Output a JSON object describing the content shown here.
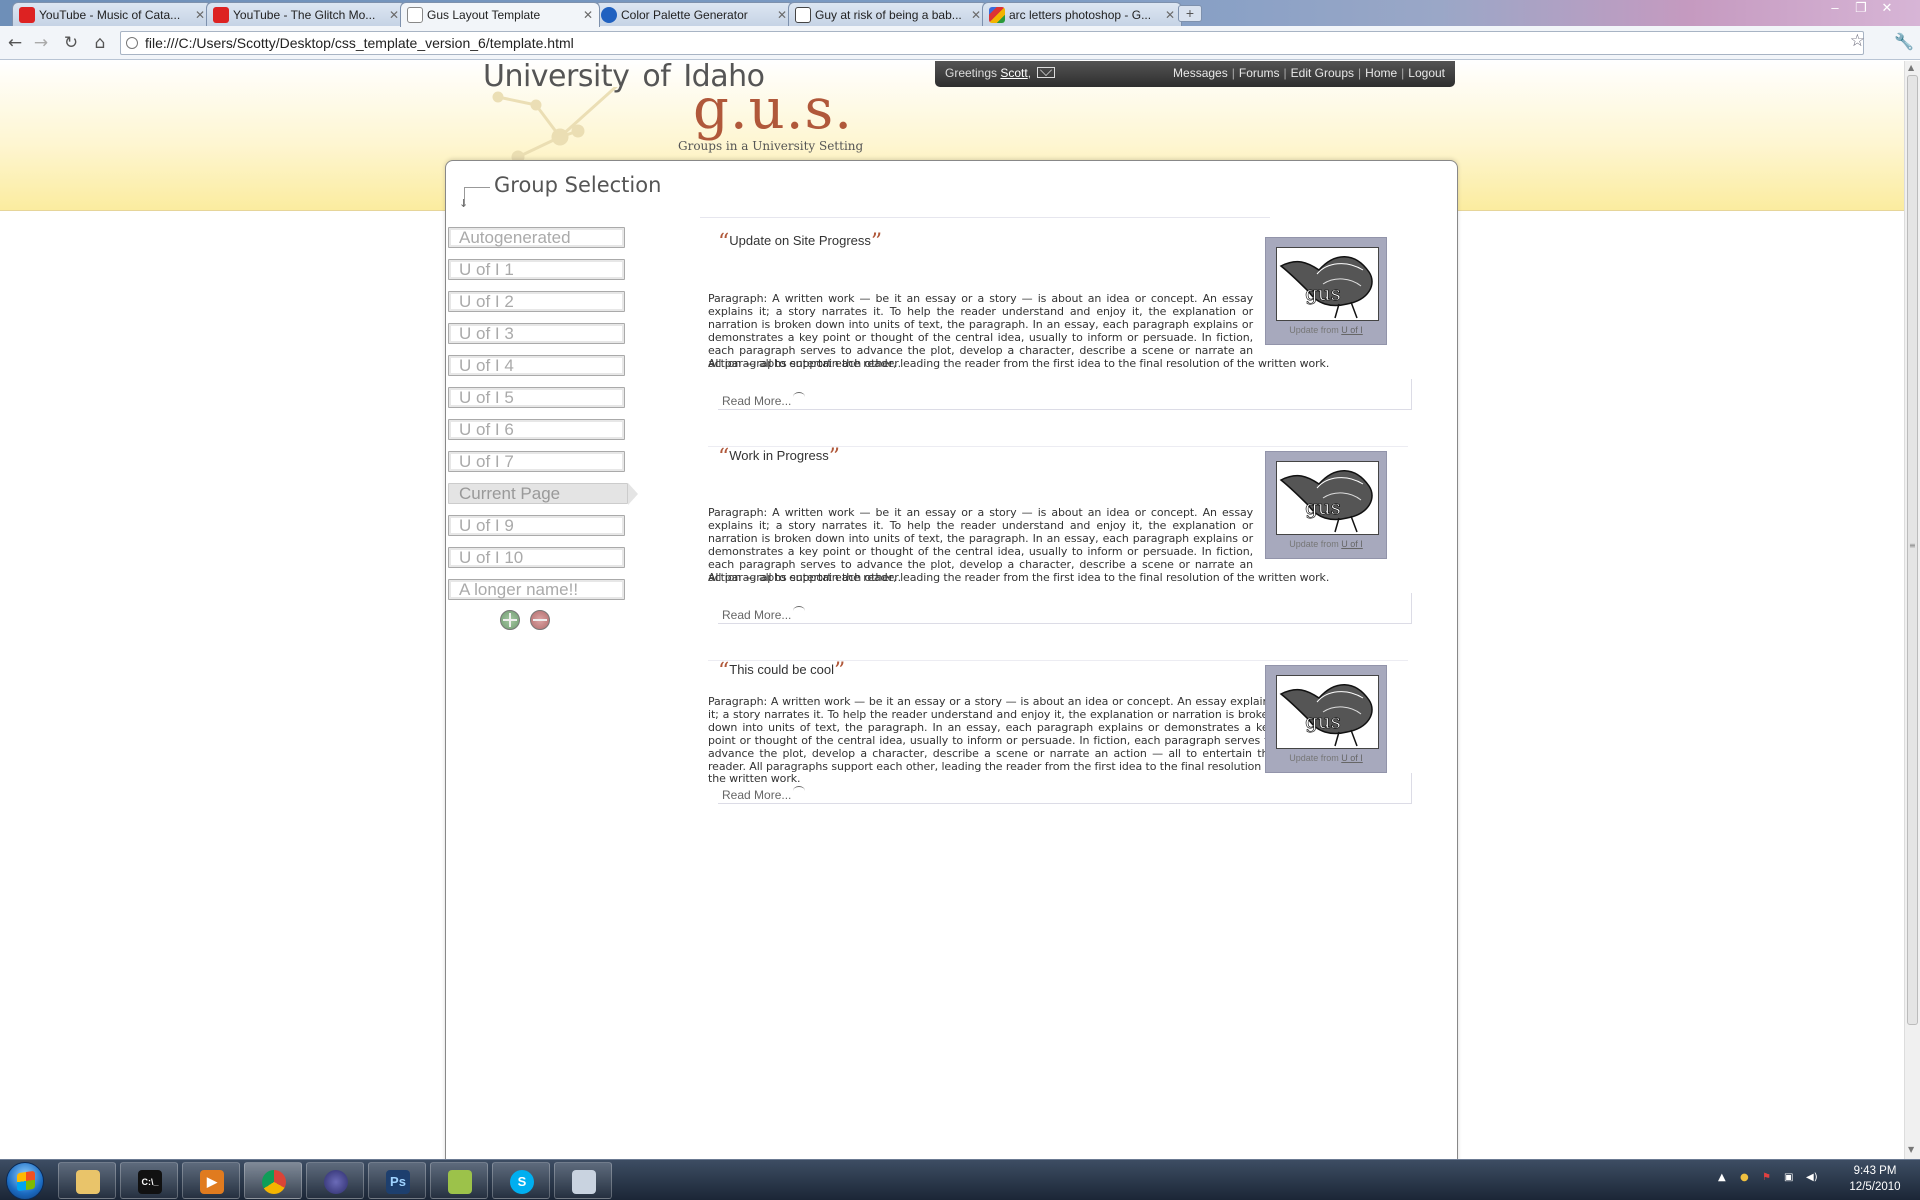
{
  "browser": {
    "tabs": [
      {
        "title": "YouTube - Music of Cata...",
        "favicon": "youtube-icon",
        "active": false
      },
      {
        "title": "YouTube - The Glitch Mo...",
        "favicon": "youtube-icon",
        "active": false
      },
      {
        "title": "Gus Layout Template",
        "favicon": "page-icon",
        "active": true
      },
      {
        "title": "Color Palette Generator",
        "favicon": "colorpalette-icon",
        "active": false
      },
      {
        "title": "Guy at risk of being a bab...",
        "favicon": "reddit-icon",
        "active": false
      },
      {
        "title": "arc letters photoshop - G...",
        "favicon": "google-icon",
        "active": false
      }
    ],
    "new_tab": "+",
    "address": "file:///C:/Users/Scotty/Desktop/css_template_version_6/template.html"
  },
  "site": {
    "university": "University  of  Idaho",
    "logo": "g.u.s.",
    "tagline": "Groups in a University Setting",
    "greeting_prefix": "Greetings",
    "username": "Scott",
    "greeting_suffix": ",",
    "nav": [
      "Messages",
      "Forums",
      "Edit Groups",
      "Home",
      "Logout"
    ],
    "nav_separator": "|"
  },
  "sidebar": {
    "title": "Group Selection",
    "groups": [
      {
        "label": "Autogenerated",
        "current": false
      },
      {
        "label": "U of I 1",
        "current": false
      },
      {
        "label": "U of I 2",
        "current": false
      },
      {
        "label": "U of I 3",
        "current": false
      },
      {
        "label": "U of I 4",
        "current": false
      },
      {
        "label": "U of I 5",
        "current": false
      },
      {
        "label": "U of I 6",
        "current": false
      },
      {
        "label": "U of I 7",
        "current": false
      },
      {
        "label": "Current Page",
        "current": true
      },
      {
        "label": "U of I 9",
        "current": false
      },
      {
        "label": "U of I 10",
        "current": false
      },
      {
        "label": "A longer name!!",
        "current": false
      }
    ]
  },
  "posts": [
    {
      "open_quote": "“",
      "title": "Update on Site Progress",
      "close_quote": "”",
      "body_wrapped": "Paragraph: A written work — be it an essay or a story — is about an idea or concept. An essay explains it; a story narrates it. To help the reader understand and enjoy it, the explanation or narration is broken down into units of text, the paragraph. In an essay, each paragraph explains or demonstrates a key point or thought of the central idea, usually to inform or persuade. In fiction, each paragraph serves to advance the plot, develop a character, describe a scene or narrate an action — all to entertain the reader.",
      "body_full": "All paragraphs support each other, leading the reader from the first idea to the final resolution of the written work.",
      "read_more": "Read More...",
      "image_caption_prefix": "Update from",
      "image_caption_link": "U of I",
      "image_text": "gus"
    },
    {
      "open_quote": "“",
      "title": "Work in Progress",
      "close_quote": "”",
      "body_wrapped": "Paragraph: A written work — be it an essay or a story — is about an idea or concept. An essay explains it; a story narrates it. To help the reader understand and enjoy it, the explanation or narration is broken down into units of text, the paragraph. In an essay, each paragraph explains or demonstrates a key point or thought of the central idea, usually to inform or persuade. In fiction, each paragraph serves to advance the plot, develop a character, describe a scene or narrate an action — all to entertain the reader.",
      "body_full": "All paragraphs support each other, leading the reader from the first idea to the final resolution of the written work.",
      "read_more": "Read More...",
      "image_caption_prefix": "Update from",
      "image_caption_link": "U of I",
      "image_text": "gus"
    },
    {
      "open_quote": "“",
      "title": "This could be cool",
      "close_quote": "”",
      "body_wrapped": "Paragraph: A written work — be it an essay or a story — is about an idea or concept. An essay explains it; a story narrates it. To help the reader understand and enjoy it, the explanation or narration is broken down into units of text, the paragraph. In an essay, each paragraph explains or demonstrates a key point or thought of the central idea, usually to inform or persuade. In fiction, each paragraph serves to advance the plot, develop a character, describe a scene or narrate an action — all to entertain the reader. All paragraphs support each other, leading the reader from the first idea to the final resolution of the written work.",
      "body_full": "",
      "read_more": "Read More...",
      "image_caption_prefix": "Update from",
      "image_caption_link": "U of I",
      "image_text": "gus"
    }
  ],
  "taskbar": {
    "apps": [
      "explorer-icon",
      "cmd-icon",
      "media-player-icon",
      "chrome-icon",
      "eclipse-icon",
      "photoshop-icon",
      "notepad-icon",
      "skype-icon",
      "paint-icon"
    ],
    "photoshop_label": "Ps",
    "cmd_label": "C:\\_",
    "time": "9:43 PM",
    "date": "12/5/2010"
  },
  "colors": {
    "accent": "#b0583a",
    "header_gradient_end": "#fbec9f",
    "userbar": "#3a3a3a",
    "thumb_bg": "#a7a9bd"
  }
}
